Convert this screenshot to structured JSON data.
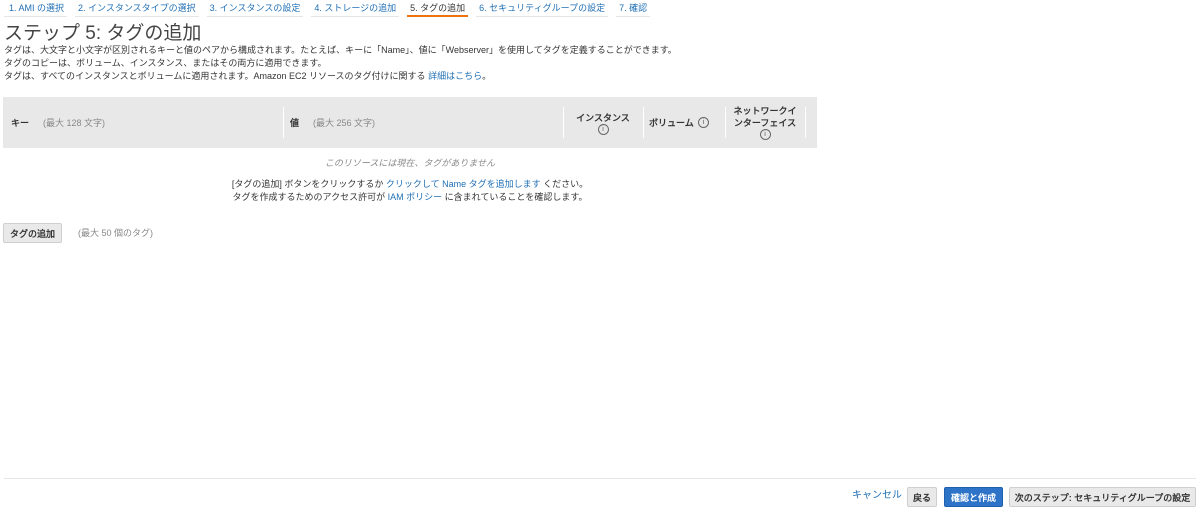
{
  "wizard": {
    "steps": [
      {
        "label": "1. AMI の選択",
        "active": false
      },
      {
        "label": "2. インスタンスタイプの選択",
        "active": false
      },
      {
        "label": "3. インスタンスの設定",
        "active": false
      },
      {
        "label": "4. ストレージの追加",
        "active": false
      },
      {
        "label": "5. タグの追加",
        "active": true
      },
      {
        "label": "6. セキュリティグループの設定",
        "active": false
      },
      {
        "label": "7. 確認",
        "active": false
      }
    ]
  },
  "page": {
    "title": "ステップ 5: タグの追加",
    "line1": "タグは、大文字と小文字が区別されるキーと値のペアから構成されます。たとえば、キーに「Name」、値に「Webserver」を使用してタグを定義することができます。",
    "line2": "タグのコピーは、ボリューム、インスタンス、またはその両方に適用できます。",
    "line3_prefix": "タグは、すべてのインスタンスとボリュームに適用されます。Amazon EC2 リソースのタグ付けに関する ",
    "line3_link": "詳細はこちら",
    "line3_suffix": "。"
  },
  "table": {
    "columns": {
      "key": {
        "label": "キー",
        "hint": "(最大 128 文字)"
      },
      "value": {
        "label": "値",
        "hint": "(最大 256 文字)"
      },
      "instances": {
        "label_line1": "インスタンス",
        "info": "i"
      },
      "volumes": {
        "label": "ボリューム",
        "info": "i"
      },
      "network": {
        "label_line1": "ネットワークイ",
        "label_line2": "ンターフェイス",
        "info": "i"
      }
    },
    "empty_message": "このリソースには現在、タグがありません",
    "instruction1_prefix": "[タグの追加] ボタンをクリックするか ",
    "instruction1_link": "クリックして Name タグを追加します",
    "instruction1_suffix": " ください。",
    "instruction2_prefix": "タグを作成するためのアクセス許可が ",
    "instruction2_link": "IAM ポリシー",
    "instruction2_suffix": " に含まれていることを確認します。"
  },
  "actions": {
    "add_tag": "タグの追加",
    "add_tag_limit": "(最大 50 個のタグ)"
  },
  "footer": {
    "cancel": "キャンセル",
    "back": "戻る",
    "review_launch": "確認と作成",
    "next": "次のステップ: セキュリティグループの設定"
  },
  "colors": {
    "accent_link": "#1f6fb5",
    "active_step_underline": "#ec7211",
    "primary_button": "#2d74c8",
    "table_header": "#e8e8e8"
  }
}
